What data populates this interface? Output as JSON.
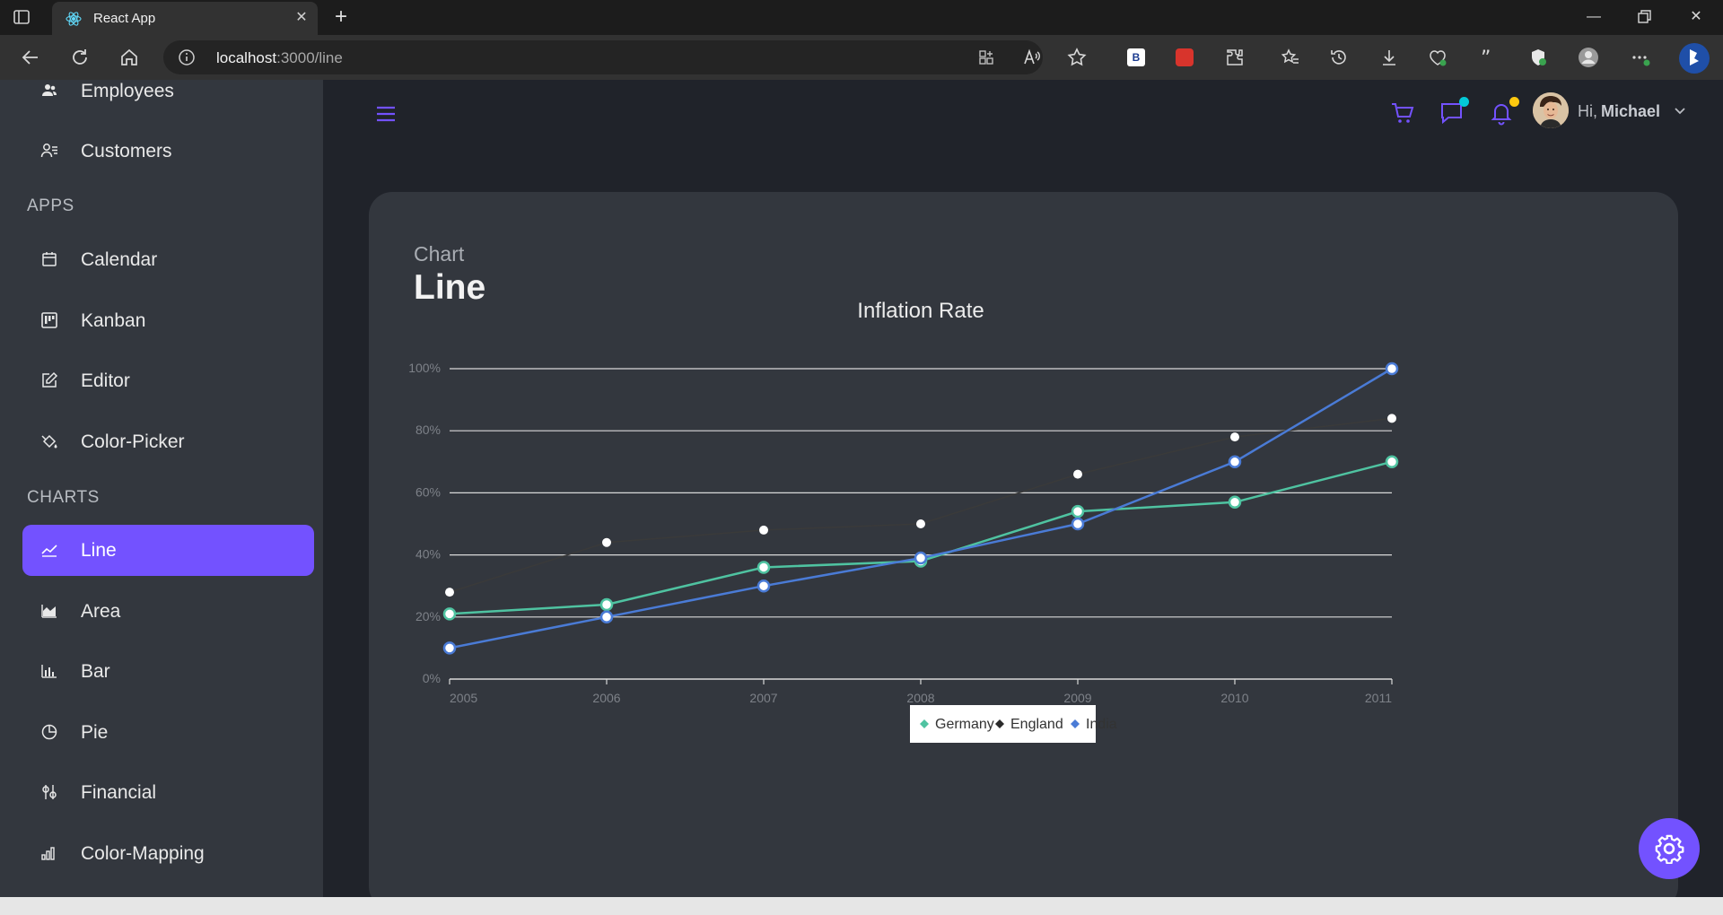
{
  "browser": {
    "tab_title": "React App",
    "url_host": "localhost",
    "url_rest": ":3000/line",
    "ext_b_label": "B"
  },
  "sidebar": {
    "items_top": [
      {
        "label": "Employees",
        "icon": "employees-icon"
      },
      {
        "label": "Customers",
        "icon": "customers-icon"
      }
    ],
    "section_apps": "APPS",
    "apps": [
      {
        "label": "Calendar",
        "icon": "calendar-icon"
      },
      {
        "label": "Kanban",
        "icon": "kanban-icon"
      },
      {
        "label": "Editor",
        "icon": "editor-icon"
      },
      {
        "label": "Color-Picker",
        "icon": "color-picker-icon"
      }
    ],
    "section_charts": "CHARTS",
    "charts": [
      {
        "label": "Line",
        "icon": "line-chart-icon",
        "active": true
      },
      {
        "label": "Area",
        "icon": "area-chart-icon"
      },
      {
        "label": "Bar",
        "icon": "bar-chart-icon"
      },
      {
        "label": "Pie",
        "icon": "pie-chart-icon"
      },
      {
        "label": "Financial",
        "icon": "financial-icon"
      },
      {
        "label": "Color-Mapping",
        "icon": "color-mapping-icon"
      }
    ]
  },
  "header": {
    "greeting": "Hi,",
    "user_name": "Michael",
    "accent": "#7352ff",
    "chat_dot": "#03c9d7",
    "bell_dot": "#fec90f"
  },
  "page": {
    "subtitle": "Chart",
    "title": "Line"
  },
  "chart_data": {
    "type": "line",
    "title": "Inflation Rate",
    "x": [
      2005,
      2006,
      2007,
      2008,
      2009,
      2010,
      2011
    ],
    "x_tick_labels": [
      "2005",
      "2006",
      "2007",
      "2008",
      "2009",
      "2010",
      "2011"
    ],
    "ylim": [
      0,
      100
    ],
    "y_ticks": [
      0,
      20,
      40,
      60,
      80,
      100
    ],
    "y_tick_labels": [
      "0%",
      "20%",
      "40%",
      "60%",
      "80%",
      "100%"
    ],
    "grid": true,
    "legend_position": "bottom",
    "series": [
      {
        "name": "Germany",
        "color": "#4fc3a1",
        "values": [
          21,
          24,
          36,
          38,
          54,
          57,
          70
        ]
      },
      {
        "name": "England",
        "color": "#3a3a3a",
        "values": [
          28,
          44,
          48,
          50,
          66,
          78,
          84
        ]
      },
      {
        "name": "India",
        "color": "#4a7bd6",
        "values": [
          10,
          20,
          30,
          39,
          50,
          70,
          100
        ]
      }
    ]
  }
}
